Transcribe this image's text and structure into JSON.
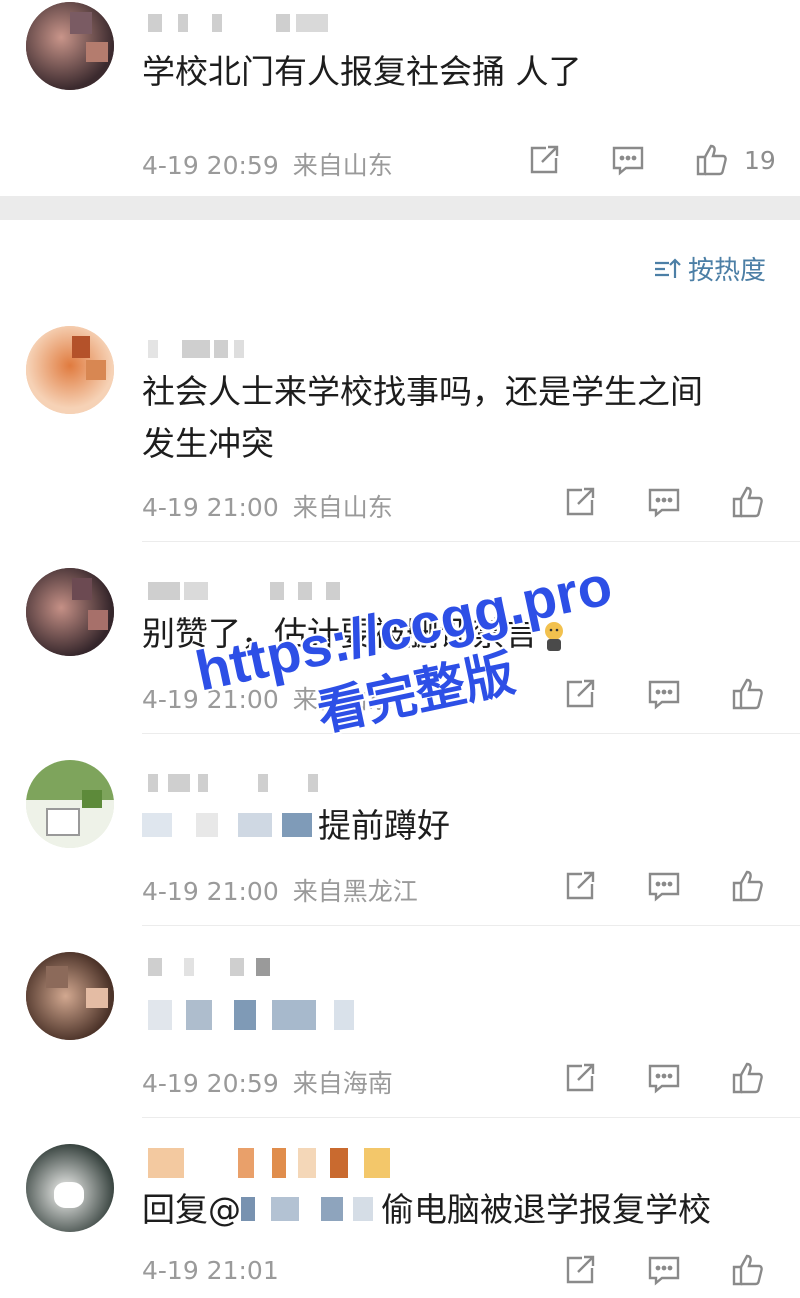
{
  "post": {
    "text": "学校北门有人报复社会捅 人了",
    "time": "4-19 20:59",
    "source": "来自山东",
    "likes": "19",
    "share_icon": "share-icon",
    "comment_icon": "comment-icon",
    "like_icon": "thumbs-up-icon"
  },
  "sort": {
    "label": "按热度",
    "icon": "sort-icon"
  },
  "comments": [
    {
      "text": "社会人士来学校找事吗，还是学生之间",
      "text2": "发生冲突",
      "time": "4-19 21:00",
      "source": "来自山东"
    },
    {
      "text": "别赞了，估计要被删评禁言",
      "time": "4-19 21:00",
      "source": "来自山东"
    },
    {
      "text": "提前蹲好",
      "time": "4-19 21:00",
      "source": "来自黑龙江"
    },
    {
      "text": "",
      "time": "4-19 20:59",
      "source": "来自海南"
    },
    {
      "text_prefix": "回复@",
      "text": "偷电脑被退学报复学校",
      "time": "4-19 21:01",
      "source": ""
    }
  ],
  "watermark": {
    "line1": "https://ccgg.pro",
    "line2": "看完整版"
  },
  "colors": {
    "link": "#4c7fa6",
    "meta": "#9a9a9a",
    "watermark": "#2d4fe6",
    "band": "#ebebeb"
  }
}
